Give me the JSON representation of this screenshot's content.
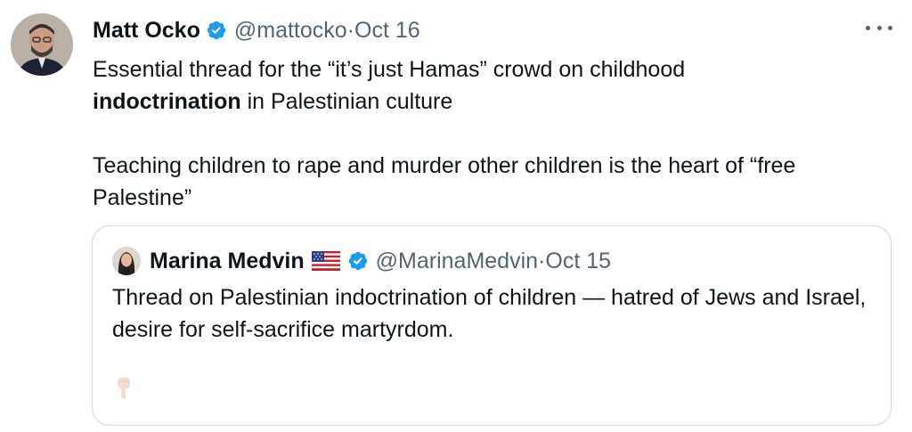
{
  "tweet": {
    "author_name": "Matt Ocko",
    "author_handle": "@mattocko",
    "date_sep": " · ",
    "date": "Oct 16",
    "more_icon": "more-horizontal-icon",
    "text_line1": "Essential thread for the “it’s just Hamas” crowd on childhood",
    "text_line2_bold": "indoctrination",
    "text_line2_rest": " in Palestinian culture",
    "text_para2": "Teaching children to rape and murder other children is the heart of “free Palestine”"
  },
  "quoted_tweet": {
    "author_name": "Marina Medvin",
    "flag_icon": "us-flag-icon",
    "author_handle": "@MarinaMedvin",
    "date_sep": " · ",
    "date": "Oct 15",
    "text": "Thread on Palestinian indoctrination of children — hatred of Jews and Israel, desire for self-sacrifice martyrdom.",
    "emoji": "👇"
  },
  "colors": {
    "verified_blue": "#1d9bf0",
    "secondary_text": "#536471",
    "border": "#cfd9de"
  }
}
